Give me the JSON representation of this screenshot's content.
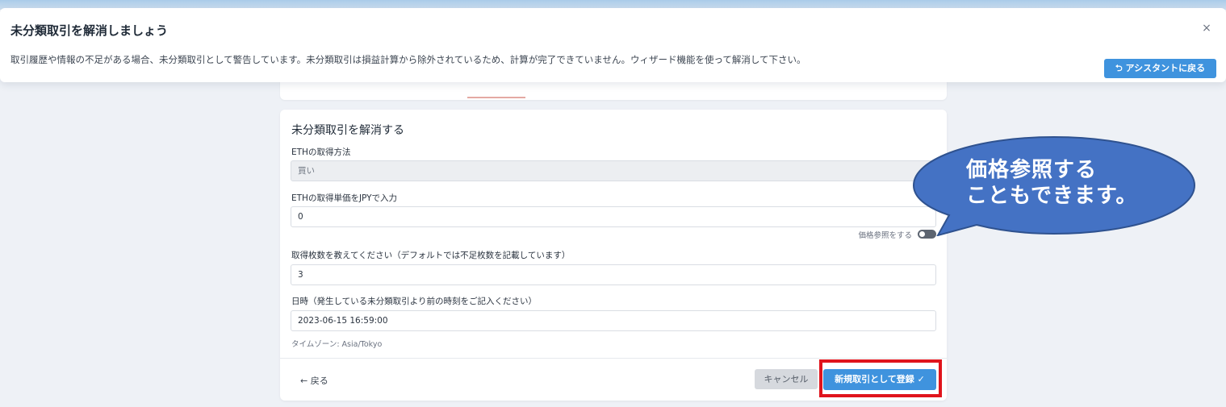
{
  "banner": {
    "title": "未分類取引を解消しましょう",
    "close_glyph": "×",
    "description": "取引履歴や情報の不足がある場合、未分類取引として警告しています。未分類取引は損益計算から除外されているため、計算が完了できていません。ウィザード機能を使って解消して下さい。",
    "assistant_button": "⮌ アシスタントに戻る"
  },
  "form": {
    "title": "未分類取引を解消する",
    "acquire_method_label": "ETHの取得方法",
    "acquire_method_value": "買い",
    "unit_price_label": "ETHの取得単価をJPYで入力",
    "unit_price_value": "0",
    "price_ref_toggle_label": "価格参照をする",
    "price_ref_enabled": false,
    "quantity_label": "取得枚数を教えてください（デフォルトでは不足枚数を記載しています）",
    "quantity_value": "3",
    "datetime_label": "日時（発生している未分類取引より前の時刻をご記入ください）",
    "datetime_value": "2023-06-15 16:59:00",
    "timezone_hint": "タイムゾーン: Asia/Tokyo"
  },
  "footer": {
    "back_label": "← 戻る",
    "cancel_label": "キャンセル",
    "submit_label": "新規取引として登録 ✓"
  },
  "callout": {
    "text": "価格参照する\nこともできます。",
    "fill_color": "#4472c4",
    "highlight_color": "#e0141c"
  },
  "colors": {
    "accent": "#3f93de",
    "background": "#eef1f6"
  }
}
